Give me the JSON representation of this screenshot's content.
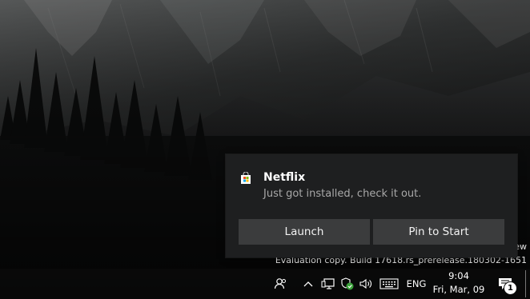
{
  "watermark": {
    "edition": "ew",
    "build": "Evaluation copy. Build 17618.rs_prerelease.180302-1651"
  },
  "notification": {
    "app_icon": "store-bag-icon",
    "title": "Netflix",
    "body": "Just got installed, check it out.",
    "buttons": {
      "launch": "Launch",
      "pin": "Pin to Start"
    },
    "colors": {
      "background": "#1e1f20",
      "button": "#3b3c3d"
    }
  },
  "taskbar": {
    "tray_icons": [
      "people-icon",
      "chevron-up-icon",
      "network-icon",
      "security-icon",
      "volume-icon",
      "touch-keyboard-icon"
    ],
    "language": "ENG",
    "clock": {
      "time": "9:04",
      "date": "Fri, Mar, 09"
    },
    "action_center": {
      "icon": "action-center-icon",
      "badge_count": "1"
    }
  }
}
